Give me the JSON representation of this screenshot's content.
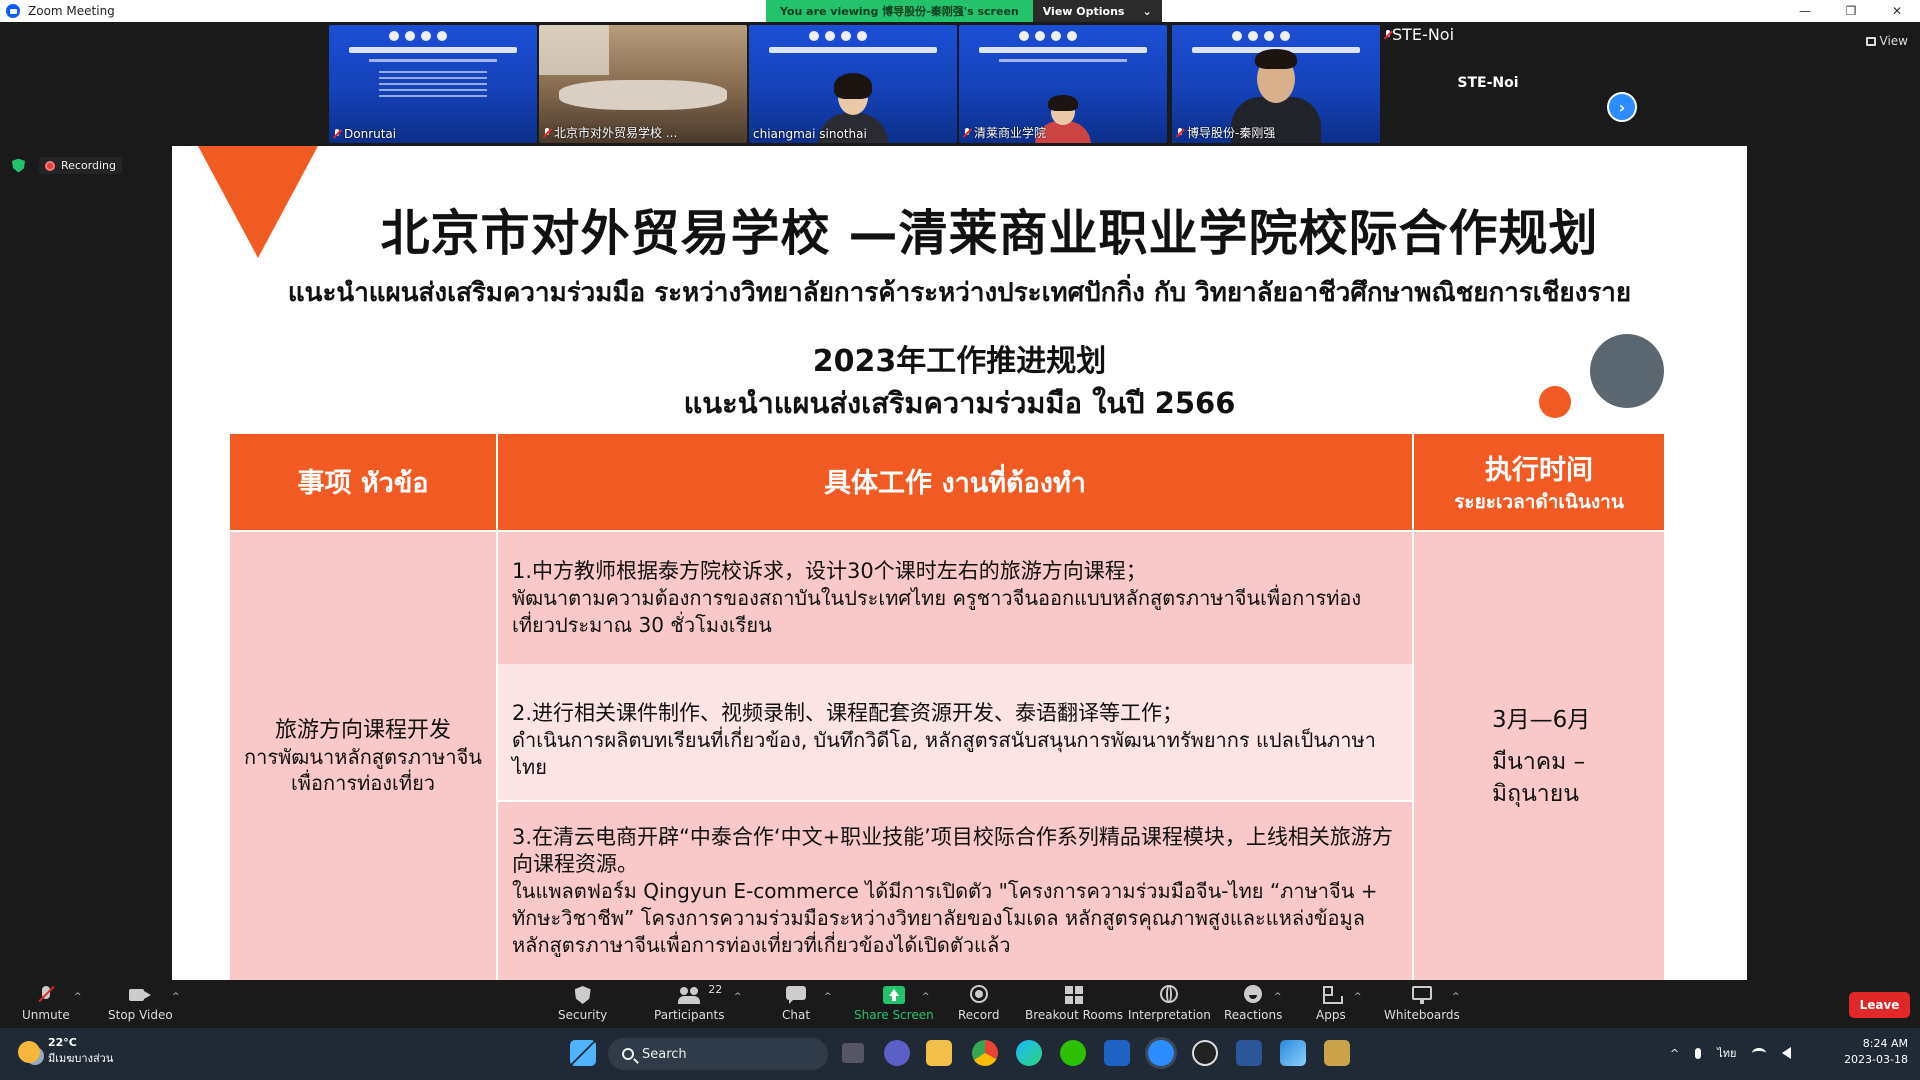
{
  "window": {
    "title": "Zoom Meeting",
    "minimize": "—",
    "maximize": "❐",
    "close": "✕"
  },
  "banner": {
    "viewing_text": "You are viewing 博导股份-秦刚强's screen",
    "view_options": "View Options",
    "chevron": "⌄"
  },
  "participants_strip": [
    {
      "name": "Donrutai",
      "kind": "screen"
    },
    {
      "name": "北京市对外贸易学校 ...",
      "kind": "room"
    },
    {
      "name": "chiangmai sinothai",
      "kind": "screen-person"
    },
    {
      "name": "清莱商业学院",
      "kind": "screen-person"
    },
    {
      "name": "博导股份-秦刚强",
      "kind": "screen-person",
      "active": true
    },
    {
      "name": "STE-Noi",
      "kind": "blank",
      "big_label": "STE-Noi"
    }
  ],
  "strip_next": "›",
  "view_button": "View",
  "recording": {
    "label": "Recording"
  },
  "slide": {
    "title_cn": "北京市对外贸易学校 —清莱商业职业学院校际合作规划",
    "title_th": "แนะนำแผนส่งเสริมความร่วมมือ  ระหว่างวิทยาลัยการค้าระหว่างประเทศปักกิ่ง กับ วิทยาลัยอาชีวศึกษาพณิชยการเชียงราย",
    "subtitle_cn": "2023年工作推进规划",
    "subtitle_th": "แนะนำแผนส่งเสริมความร่วมมือ ในปี 2566",
    "table": {
      "headers": [
        {
          "a": "事项 หัวข้อ",
          "b": ""
        },
        {
          "a": "具体工作 งานที่ต้องทำ",
          "b": ""
        },
        {
          "a": "执行时间",
          "b": "ระยะเวลาดำเนินงาน"
        }
      ],
      "topic_cn": "旅游方向课程开发",
      "topic_th": "การพัฒนาหลักสูตรภาษาจีนเพื่อการท่องเที่ยว",
      "tasks": [
        {
          "cn": "1.中方教师根据泰方院校诉求，设计30个课时左右的旅游方向课程；",
          "th": "พัฒนาตามความต้องการของสถาบันในประเทศไทย  ครูชาวจีนออกแบบหลักสูตรภาษาจีนเพื่อการท่องเที่ยวประมาณ  30 ชั่วโมงเรียน"
        },
        {
          "cn": "2.进行相关课件制作、视频录制、课程配套资源开发、泰语翻译等工作；",
          "th": "ดำเนินการผลิตบทเรียนที่เกี่ยวข้อง, บันทึกวิดีโอ, หลักสูตรสนับสนุนการพัฒนาทรัพยากร   แปลเป็นภาษาไทย"
        },
        {
          "cn": "3.在清云电商开辟“中泰合作‘中文+职业技能’项目校际合作系列精品课程模块，上线相关旅游方向课程资源。",
          "th": "ในแพลตฟอร์ม Qingyun E-commerce ได้มีการเปิดตัว \"โครงการความร่วมมือจีน-ไทย   “ภาษาจีน + ทักษะวิชาชีพ”   โครงการความร่วมมือระหว่างวิทยาลัยของโมเดล  หลักสูตรคุณภาพสูงและแหล่งข้อมูลหลักสูตรภาษาจีนเพื่อการท่องเที่ยวที่เกี่ยวข้องได้เปิดตัวแล้ว"
        }
      ],
      "time_cn": "3月—6月",
      "time_th": "มีนาคม  –  มิถุนายน"
    }
  },
  "toolbar": {
    "unmute": "Unmute",
    "stop_video": "Stop Video",
    "security": "Security",
    "participants": "Participants",
    "participants_count": "22",
    "chat": "Chat",
    "share_screen": "Share Screen",
    "record": "Record",
    "breakout": "Breakout Rooms",
    "interpretation": "Interpretation",
    "reactions": "Reactions",
    "apps": "Apps",
    "whiteboards": "Whiteboards",
    "leave": "Leave",
    "caret": "^"
  },
  "taskbar": {
    "temp": "22°C",
    "weather": "มีเมฆบางส่วน",
    "search": "Search",
    "lang": "ไทย",
    "time": "8:24 AM",
    "date": "2023-03-18",
    "tray_up": "^"
  },
  "colors": {
    "accent": "#f15a22",
    "cell_pink": "#f9c9c9",
    "cell_light": "#fde4e4",
    "zoom_blue": "#2d8cff",
    "green": "#23c26b",
    "leave_red": "#e02828"
  }
}
